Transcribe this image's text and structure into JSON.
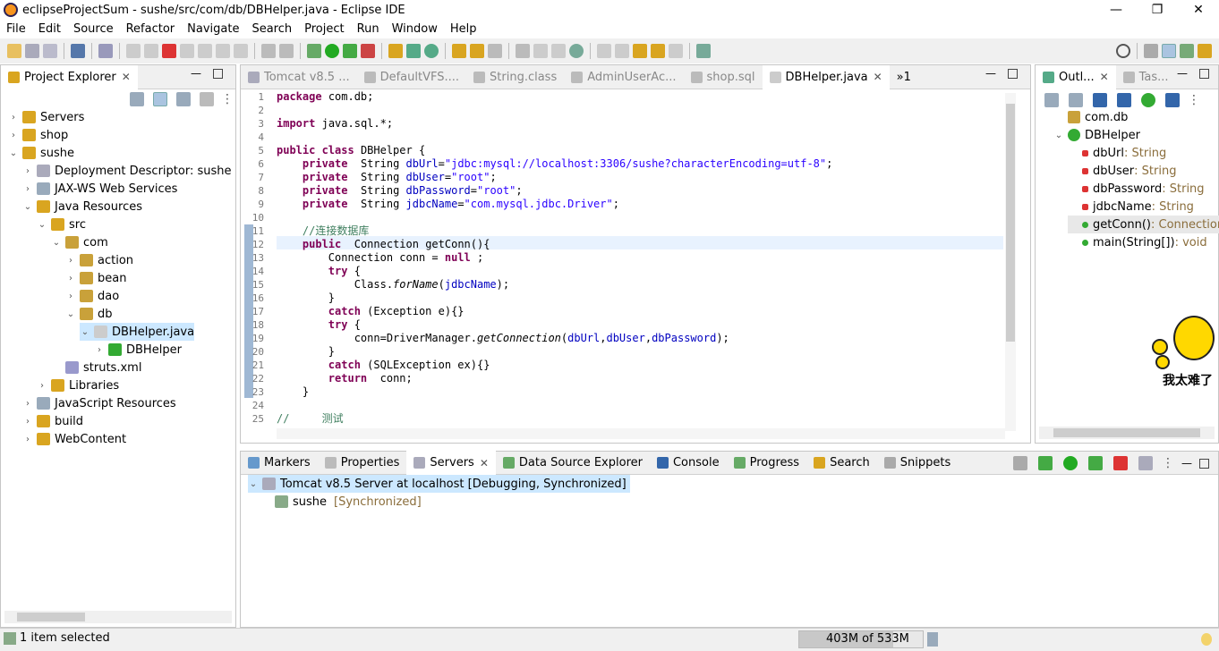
{
  "window": {
    "title": "eclipseProjectSum - sushe/src/com/db/DBHelper.java - Eclipse IDE",
    "minimize": "—",
    "maximize": "❐",
    "close": "✕"
  },
  "menu": [
    "File",
    "Edit",
    "Source",
    "Refactor",
    "Navigate",
    "Search",
    "Project",
    "Run",
    "Window",
    "Help"
  ],
  "project_explorer": {
    "tab_label": "Project Explorer",
    "items": [
      {
        "label": "Servers",
        "depth": 0,
        "twisty": "›"
      },
      {
        "label": "shop",
        "depth": 0,
        "twisty": "›"
      },
      {
        "label": "sushe",
        "depth": 0,
        "twisty": "⌄"
      },
      {
        "label": "Deployment Descriptor: sushe",
        "depth": 1,
        "twisty": "›"
      },
      {
        "label": "JAX-WS Web Services",
        "depth": 1,
        "twisty": "›"
      },
      {
        "label": "Java Resources",
        "depth": 1,
        "twisty": "⌄"
      },
      {
        "label": "src",
        "depth": 2,
        "twisty": "⌄"
      },
      {
        "label": "com",
        "depth": 3,
        "twisty": "⌄"
      },
      {
        "label": "action",
        "depth": 4,
        "twisty": "›"
      },
      {
        "label": "bean",
        "depth": 4,
        "twisty": "›"
      },
      {
        "label": "dao",
        "depth": 4,
        "twisty": "›"
      },
      {
        "label": "db",
        "depth": 4,
        "twisty": "⌄"
      },
      {
        "label": "DBHelper.java",
        "depth": 5,
        "twisty": "⌄"
      },
      {
        "label": "DBHelper",
        "depth": 6,
        "twisty": "›"
      },
      {
        "label": "struts.xml",
        "depth": 3,
        "twisty": ""
      },
      {
        "label": "Libraries",
        "depth": 2,
        "twisty": "›"
      },
      {
        "label": "JavaScript Resources",
        "depth": 1,
        "twisty": "›"
      },
      {
        "label": "build",
        "depth": 1,
        "twisty": "›"
      },
      {
        "label": "WebContent",
        "depth": 1,
        "twisty": "›"
      }
    ]
  },
  "editor": {
    "tabs": [
      "Tomcat v8.5 ...",
      "DefaultVFS....",
      "String.class",
      "AdminUserAc...",
      "shop.sql",
      "DBHelper.java"
    ],
    "overflow": "»1",
    "lines": [
      {
        "n": "1",
        "segs": [
          [
            "kw",
            "package"
          ],
          [
            "",
            "com.db;"
          ]
        ]
      },
      {
        "n": "2",
        "segs": []
      },
      {
        "n": "3",
        "segs": [
          [
            "kw",
            "import"
          ],
          [
            "",
            "java.sql.*;"
          ]
        ]
      },
      {
        "n": "4",
        "segs": []
      },
      {
        "n": "5",
        "segs": [
          [
            "kw",
            "public class"
          ],
          [
            "",
            "DBHelper {"
          ]
        ]
      },
      {
        "n": "6",
        "segs": [
          [
            "",
            "    "
          ],
          [
            "kw",
            "private"
          ],
          [
            "",
            " String "
          ],
          [
            "fld",
            "dbUrl"
          ],
          [
            "",
            "="
          ],
          [
            "str",
            "\"jdbc:mysql://localhost:3306/sushe?characterEncoding=utf-8\""
          ],
          [
            "",
            ";"
          ]
        ]
      },
      {
        "n": "7",
        "segs": [
          [
            "",
            "    "
          ],
          [
            "kw",
            "private"
          ],
          [
            "",
            " String "
          ],
          [
            "fld",
            "dbUser"
          ],
          [
            "",
            "="
          ],
          [
            "str",
            "\"root\""
          ],
          [
            "",
            ";"
          ]
        ]
      },
      {
        "n": "8",
        "segs": [
          [
            "",
            "    "
          ],
          [
            "kw",
            "private"
          ],
          [
            "",
            " String "
          ],
          [
            "fld",
            "dbPassword"
          ],
          [
            "",
            "="
          ],
          [
            "str",
            "\"root\""
          ],
          [
            "",
            ";"
          ]
        ]
      },
      {
        "n": "9",
        "segs": [
          [
            "",
            "    "
          ],
          [
            "kw",
            "private"
          ],
          [
            "",
            " String "
          ],
          [
            "fld",
            "jdbcName"
          ],
          [
            "",
            "="
          ],
          [
            "str",
            "\"com.mysql.jdbc.Driver\""
          ],
          [
            "",
            ";"
          ]
        ]
      },
      {
        "n": "10",
        "segs": []
      },
      {
        "n": "11",
        "segs": [
          [
            "",
            "    "
          ],
          [
            "cmt",
            "//连接数据库"
          ]
        ]
      },
      {
        "n": "12",
        "segs": [
          [
            "",
            "    "
          ],
          [
            "kw",
            "public"
          ],
          [
            "",
            " Connection getConn(){"
          ]
        ]
      },
      {
        "n": "13",
        "segs": [
          [
            "",
            "        Connection conn = "
          ],
          [
            "kw",
            "null"
          ],
          [
            "",
            ";"
          ]
        ]
      },
      {
        "n": "14",
        "segs": [
          [
            "",
            "        "
          ],
          [
            "kw",
            "try"
          ],
          [
            "",
            "{"
          ]
        ]
      },
      {
        "n": "15",
        "segs": [
          [
            "",
            "            Class."
          ],
          [
            "it",
            "forName"
          ],
          [
            "",
            "("
          ],
          [
            "fld",
            "jdbcName"
          ],
          [
            "",
            ");"
          ]
        ]
      },
      {
        "n": "16",
        "segs": [
          [
            "",
            "        }"
          ]
        ]
      },
      {
        "n": "17",
        "segs": [
          [
            "",
            "        "
          ],
          [
            "kw",
            "catch"
          ],
          [
            "",
            "(Exception e){}"
          ]
        ]
      },
      {
        "n": "18",
        "segs": [
          [
            "",
            "        "
          ],
          [
            "kw",
            "try"
          ],
          [
            "",
            "{"
          ]
        ]
      },
      {
        "n": "19",
        "segs": [
          [
            "",
            "            conn=DriverManager."
          ],
          [
            "it",
            "getConnection"
          ],
          [
            "",
            "("
          ],
          [
            "fld",
            "dbUrl"
          ],
          [
            "",
            ","
          ],
          [
            "fld",
            "dbUser"
          ],
          [
            "",
            ","
          ],
          [
            "fld",
            "dbPassword"
          ],
          [
            "",
            ");"
          ]
        ]
      },
      {
        "n": "20",
        "segs": [
          [
            "",
            "        }"
          ]
        ]
      },
      {
        "n": "21",
        "segs": [
          [
            "",
            "        "
          ],
          [
            "kw",
            "catch"
          ],
          [
            "",
            "(SQLException ex){}"
          ]
        ]
      },
      {
        "n": "22",
        "segs": [
          [
            "",
            "        "
          ],
          [
            "kw",
            "return"
          ],
          [
            "",
            " conn;"
          ]
        ]
      },
      {
        "n": "23",
        "segs": [
          [
            "",
            "    }"
          ]
        ]
      },
      {
        "n": "24",
        "segs": []
      },
      {
        "n": "25",
        "segs": [
          [
            "cmt",
            "//     测试"
          ]
        ]
      }
    ]
  },
  "outline": {
    "tab1": "Outl...",
    "tab2": "Tas...",
    "items": [
      {
        "label": "com.db",
        "type": ""
      },
      {
        "label": "DBHelper",
        "type": ""
      },
      {
        "label": "dbUrl",
        "type": " : String"
      },
      {
        "label": "dbUser",
        "type": " : String"
      },
      {
        "label": "dbPassword",
        "type": " : String"
      },
      {
        "label": "jdbcName",
        "type": " : String"
      },
      {
        "label": "getConn()",
        "type": " : Connection"
      },
      {
        "label": "main(String[])",
        "type": " : void"
      }
    ],
    "sticker_text": "我太难了"
  },
  "bottom": {
    "tabs": [
      "Markers",
      "Properties",
      "Servers",
      "Data Source Explorer",
      "Console",
      "Progress",
      "Search",
      "Snippets"
    ],
    "server": "Tomcat v8.5 Server at localhost  [Debugging, Synchronized]",
    "module": "sushe",
    "module_state": "[Synchronized]"
  },
  "status": {
    "left": "1 item selected",
    "heap": "403M of 533M"
  }
}
